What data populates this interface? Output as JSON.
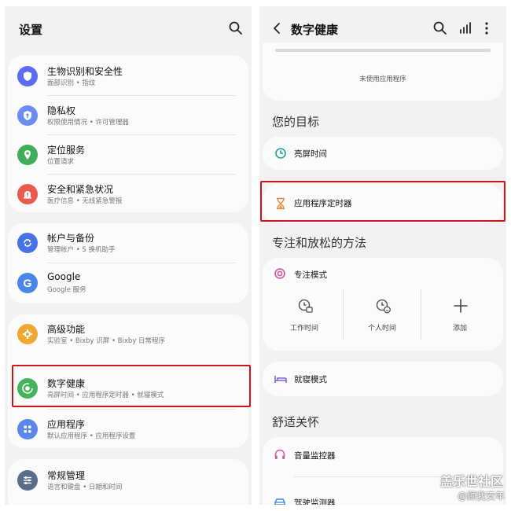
{
  "left": {
    "header": {
      "title": "设置",
      "search_icon": "search-icon"
    },
    "groups": [
      {
        "items": [
          {
            "icon": "shield-icon",
            "color": "#5b6cf0",
            "title": "生物识别和安全性",
            "subtitle": "面部识别 • 指纹"
          },
          {
            "icon": "privacy-icon",
            "color": "#6c8cf2",
            "title": "隐私权",
            "subtitle": "权限使用情况 • 许可管理器"
          },
          {
            "icon": "location-icon",
            "color": "#3fae5a",
            "title": "定位服务",
            "subtitle": "位置请求"
          },
          {
            "icon": "emergency-icon",
            "color": "#ea5b4f",
            "title": "安全和紧急状况",
            "subtitle": "医疗信息 • 无线紧急警报"
          }
        ]
      },
      {
        "items": [
          {
            "icon": "sync-icon",
            "color": "#4a72e8",
            "title": "帐户与备份",
            "subtitle": "管理帐户 • S 换机助手"
          },
          {
            "icon": "google-icon",
            "color": "#4a86e8",
            "title": "Google",
            "subtitle": "Google 服务"
          }
        ]
      },
      {
        "items": [
          {
            "icon": "advanced-features-icon",
            "color": "#f0a830",
            "title": "高级功能",
            "subtitle": "实验室 • Bixby 识屏 • Bixby 日常程序"
          },
          {
            "icon": "digital-wellbeing-icon",
            "color": "#45b35a",
            "title": "数字健康",
            "subtitle": "亮屏时间 • 应用程序定时器 • 就寝模式"
          },
          {
            "icon": "apps-icon",
            "color": "#5b86ec",
            "title": "应用程序",
            "subtitle": "默认应用程序 • 应用程序设置"
          }
        ]
      },
      {
        "items": [
          {
            "icon": "general-management-icon",
            "color": "#5a6e8a",
            "title": "常规管理",
            "subtitle": "语言和键盘 • 日期和时间"
          }
        ]
      }
    ]
  },
  "right": {
    "header": {
      "title": "数字健康",
      "back_icon": "back-arrow-icon",
      "search_icon": "search-icon",
      "stats_icon": "bar-chart-icon",
      "more_icon": "more-vertical-icon"
    },
    "unused_apps": "未使用应用程序",
    "goals_title": "您的目标",
    "screen_time": "亮屏时间",
    "app_timer": "应用程序定时器",
    "focus_title": "专注和放松的方法",
    "focus_mode": "专注模式",
    "modes": [
      {
        "icon": "work-time-icon",
        "label": "工作时间"
      },
      {
        "icon": "personal-time-icon",
        "label": "个人时间"
      },
      {
        "icon": "add-icon",
        "label": "添加"
      }
    ],
    "bedtime_mode": "就寝模式",
    "care_title": "舒适关怀",
    "volume_monitor": "音量监控器",
    "driving_monitor": "驾驶监测器"
  },
  "watermark": {
    "site": "盖乐世社区",
    "author": "@顾我安年"
  },
  "colors": {
    "highlight": "#d0141d",
    "teal": "#1aa39a",
    "pink": "#d6569b",
    "purple": "#7b5fd6"
  }
}
